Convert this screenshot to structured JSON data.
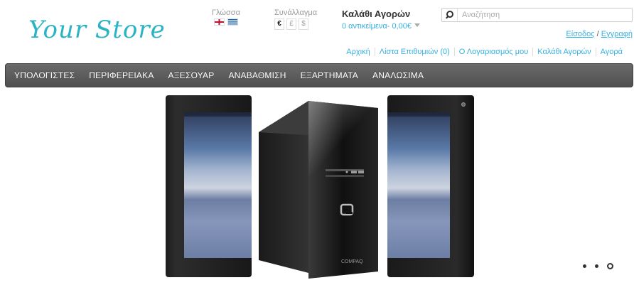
{
  "logo": {
    "text": "Your Store"
  },
  "language": {
    "label": "Γλώσσα",
    "flags": [
      "gb-flag",
      "gr-flag"
    ]
  },
  "currency": {
    "label": "Συνάλλαγμα",
    "options": [
      "€",
      "£",
      "$"
    ],
    "selected": "€"
  },
  "cart": {
    "title": "Καλάθι Αγορών",
    "summary": "0 αντικείμενα- 0,00€"
  },
  "search": {
    "placeholder": "Αναζήτηση"
  },
  "account": {
    "login": "Είσοδος",
    "separator": "/",
    "register": "Εγγραφή"
  },
  "top_links": [
    "Αρχική",
    "Λίστα Επιθυμιών (0)",
    "Ο Λογαριασμός μου",
    "Καλάθι Αγορών",
    "Αγορά"
  ],
  "menu": [
    "ΥΠΟΛΟΓΙΣΤΕΣ",
    "ΠΕΡΙΦΕΡΕΙΑΚΑ",
    "ΑΞΕΣΟΥΑΡ",
    "ΑΝΑΒΑΘΜΙΣΗ",
    "ΕΞΑΡΤΗΜΑΤΑ",
    "ΑΝΑΛΩΣΙΜΑ"
  ],
  "slideshow": {
    "slides": [
      "tablet-image",
      "desktop-pc-image",
      "tablet-image"
    ],
    "pc_brand": "COMPAQ",
    "pagination": {
      "count": 3,
      "active": 3
    }
  },
  "colors": {
    "accent": "#38b0de",
    "logo": "#2bb3c4",
    "menubar": "#5c5c5c"
  }
}
